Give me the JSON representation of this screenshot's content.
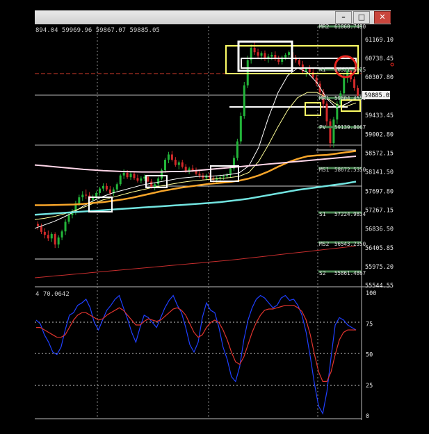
{
  "window": {
    "minimize_glyph": "–",
    "maximize_glyph": "□",
    "close_glyph": "✕"
  },
  "main_chart": {
    "ohlc_label": "894.04 59969.96 59867.07 59885.05",
    "price_axis": [
      "61169.10",
      "60738.45",
      "60307.80",
      "59885.05",
      "59433.45",
      "59002.80",
      "58572.15",
      "58141.50",
      "57697.80",
      "57267.15",
      "56836.50",
      "56405.85",
      "55975.20",
      "55544.55"
    ],
    "current_price": "59885.05",
    "pivot_labels": [
      {
        "name": "MR2",
        "value": "61060.7490"
      },
      {
        "name": "R1",
        "value": "60521.5125"
      },
      {
        "name": "MR1",
        "value": "59804.4550"
      },
      {
        "name": "PV",
        "value": "59139.8067"
      },
      {
        "name": "MS1",
        "value": "58672.5350"
      },
      {
        "name": "S1",
        "value": "57224.9834"
      },
      {
        "name": "MS2",
        "value": "56543.2350"
      },
      {
        "name": "S2",
        "value": "55861.4867"
      }
    ]
  },
  "oscillator": {
    "label": "4 70.0642",
    "axis": [
      "100",
      "75",
      "50",
      "25",
      "0"
    ]
  },
  "chart_data": [
    {
      "type": "candlestick",
      "ylim": [
        55544.55,
        61380
      ],
      "candles": [
        [
          56950,
          57010,
          56820,
          56900
        ],
        [
          56900,
          56960,
          56720,
          56770
        ],
        [
          56770,
          56850,
          56620,
          56700
        ],
        [
          56700,
          56800,
          56560,
          56620
        ],
        [
          56620,
          56760,
          56540,
          56720
        ],
        [
          56720,
          56760,
          56400,
          56480
        ],
        [
          56480,
          56690,
          56400,
          56640
        ],
        [
          56640,
          56820,
          56580,
          56780
        ],
        [
          56780,
          57060,
          56700,
          57000
        ],
        [
          57000,
          57200,
          56950,
          57150
        ],
        [
          57150,
          57290,
          57080,
          57220
        ],
        [
          57220,
          57480,
          57160,
          57420
        ],
        [
          57420,
          57620,
          57360,
          57560
        ],
        [
          57560,
          57700,
          57480,
          57620
        ],
        [
          57620,
          57740,
          57520,
          57600
        ],
        [
          57600,
          57680,
          57440,
          57500
        ],
        [
          57500,
          57620,
          57420,
          57580
        ],
        [
          57580,
          57700,
          57520,
          57660
        ],
        [
          57660,
          57800,
          57600,
          57760
        ],
        [
          57760,
          57880,
          57700,
          57820
        ],
        [
          57820,
          57880,
          57700,
          57740
        ],
        [
          57740,
          57820,
          57600,
          57650
        ],
        [
          57650,
          57790,
          57590,
          57740
        ],
        [
          57740,
          57900,
          57680,
          57860
        ],
        [
          57860,
          58100,
          57820,
          58060
        ],
        [
          58060,
          58200,
          57980,
          58120
        ],
        [
          58120,
          58180,
          57980,
          58020
        ],
        [
          58020,
          58140,
          57960,
          58100
        ],
        [
          58100,
          58160,
          57960,
          58000
        ],
        [
          58000,
          58080,
          57900,
          57940
        ],
        [
          57940,
          58040,
          57880,
          57990
        ],
        [
          57990,
          58080,
          57930,
          58030
        ],
        [
          58030,
          58070,
          57900,
          57920
        ],
        [
          57920,
          57980,
          57760,
          57800
        ],
        [
          57800,
          57900,
          57720,
          57860
        ],
        [
          57860,
          58030,
          57820,
          57990
        ],
        [
          57990,
          58220,
          57950,
          58180
        ],
        [
          58180,
          58460,
          58120,
          58420
        ],
        [
          58420,
          58600,
          58340,
          58540
        ],
        [
          58540,
          58620,
          58380,
          58420
        ],
        [
          58420,
          58480,
          58260,
          58300
        ],
        [
          58300,
          58400,
          58200,
          58360
        ],
        [
          58360,
          58420,
          58220,
          58260
        ],
        [
          58260,
          58320,
          58120,
          58170
        ],
        [
          58170,
          58260,
          58090,
          58220
        ],
        [
          58220,
          58300,
          58140,
          58180
        ],
        [
          58180,
          58240,
          58060,
          58100
        ],
        [
          58100,
          58160,
          58000,
          58060
        ],
        [
          58060,
          58120,
          57960,
          58000
        ],
        [
          58000,
          58100,
          57950,
          58060
        ],
        [
          58060,
          58120,
          57960,
          58000
        ],
        [
          58000,
          58060,
          57900,
          57960
        ],
        [
          57960,
          58040,
          57900,
          58000
        ],
        [
          58000,
          58080,
          57940,
          58020
        ],
        [
          58020,
          58080,
          57960,
          58040
        ],
        [
          58040,
          58120,
          57980,
          58080
        ],
        [
          58080,
          58260,
          58020,
          58220
        ],
        [
          58220,
          58520,
          58160,
          58460
        ],
        [
          58460,
          58900,
          58400,
          58840
        ],
        [
          58840,
          59500,
          58780,
          59420
        ],
        [
          59420,
          60200,
          59360,
          60120
        ],
        [
          60120,
          60800,
          60060,
          60700
        ],
        [
          60700,
          61060,
          60620,
          60980
        ],
        [
          60980,
          61100,
          60820,
          60880
        ],
        [
          60880,
          60960,
          60720,
          60800
        ],
        [
          60800,
          60900,
          60700,
          60860
        ],
        [
          60860,
          60920,
          60680,
          60740
        ],
        [
          60740,
          60840,
          60640,
          60780
        ],
        [
          60780,
          60880,
          60700,
          60820
        ],
        [
          60820,
          60900,
          60680,
          60720
        ],
        [
          60720,
          60800,
          60600,
          60660
        ],
        [
          60660,
          60800,
          60600,
          60760
        ],
        [
          60760,
          60860,
          60700,
          60820
        ],
        [
          60820,
          60920,
          60760,
          60880
        ],
        [
          60880,
          60900,
          60720,
          60760
        ],
        [
          60760,
          60820,
          60640,
          60700
        ],
        [
          60700,
          60760,
          60560,
          60600
        ],
        [
          60600,
          60680,
          60380,
          60440
        ],
        [
          60440,
          60540,
          60320,
          60500
        ],
        [
          60500,
          60580,
          60380,
          60420
        ],
        [
          60420,
          60500,
          60260,
          60300
        ],
        [
          60300,
          60360,
          60100,
          60160
        ],
        [
          60160,
          60220,
          59900,
          59960
        ],
        [
          59960,
          60040,
          59600,
          59700
        ],
        [
          59700,
          59760,
          59200,
          59300
        ],
        [
          59300,
          59360,
          58700,
          58800
        ],
        [
          58800,
          59400,
          58700,
          59340
        ],
        [
          59340,
          59760,
          59240,
          59700
        ],
        [
          59700,
          60000,
          59620,
          59940
        ],
        [
          59940,
          60400,
          59880,
          60320
        ],
        [
          60320,
          60520,
          60180,
          60460
        ],
        [
          60460,
          60540,
          60200,
          60260
        ],
        [
          60260,
          60320,
          60000,
          60060
        ],
        [
          60060,
          60120,
          59840,
          59885
        ]
      ]
    },
    {
      "type": "line",
      "series": [
        {
          "color": "#ffffff",
          "values": [
            56850,
            56930,
            57010,
            57110,
            57220,
            57360,
            57480,
            57580,
            57660,
            57720,
            57780,
            57840,
            57880,
            57920,
            57960,
            58000,
            58020,
            58040,
            58040,
            58060,
            58080,
            58120,
            58280,
            58700,
            59380,
            59960,
            60350,
            60520,
            60420,
            60180,
            59820,
            59600,
            59700,
            59820
          ]
        },
        {
          "color": "#ffff99",
          "values": [
            57050,
            57080,
            57120,
            57180,
            57250,
            57330,
            57420,
            57500,
            57560,
            57620,
            57680,
            57730,
            57780,
            57820,
            57860,
            57900,
            57930,
            57950,
            57970,
            57990,
            58010,
            58040,
            58130,
            58380,
            58760,
            59180,
            59560,
            59840,
            59960,
            59960,
            59840,
            59680,
            59640,
            59720
          ]
        },
        {
          "color": "#f7a52a",
          "values": [
            57380,
            57380,
            57385,
            57390,
            57395,
            57410,
            57430,
            57450,
            57480,
            57510,
            57550,
            57600,
            57650,
            57700,
            57740,
            57780,
            57810,
            57840,
            57870,
            57890,
            57910,
            57940,
            57990,
            58060,
            58150,
            58260,
            58360,
            58440,
            58500,
            58520,
            58530,
            58560,
            58590,
            58620
          ]
        },
        {
          "color": "#ffd6e8",
          "values": [
            58300,
            58280,
            58260,
            58240,
            58220,
            58200,
            58185,
            58170,
            58160,
            58150,
            58145,
            58140,
            58140,
            58140,
            58150,
            58150,
            58160,
            58180,
            58200,
            58220,
            58240,
            58260,
            58280,
            58300,
            58320,
            58340,
            58360,
            58380,
            58400,
            58420,
            58440,
            58460,
            58480,
            58500
          ]
        },
        {
          "color": "#72e4e0",
          "values": [
            57160,
            57175,
            57190,
            57205,
            57220,
            57235,
            57250,
            57265,
            57280,
            57295,
            57310,
            57325,
            57340,
            57355,
            57370,
            57385,
            57400,
            57415,
            57430,
            57450,
            57475,
            57500,
            57530,
            57570,
            57610,
            57650,
            57690,
            57730,
            57760,
            57790,
            57820,
            57850,
            57880,
            57920
          ]
        },
        {
          "color": "#c62d2d",
          "values": [
            55720,
            55740,
            55760,
            55780,
            55800,
            55820,
            55840,
            55860,
            55880,
            55900,
            55920,
            55940,
            55960,
            55980,
            56000,
            56020,
            56040,
            56060,
            56080,
            56100,
            56120,
            56145,
            56170,
            56195,
            56220,
            56245,
            56270,
            56295,
            56320,
            56345,
            56370,
            56395,
            56420,
            56450
          ]
        }
      ]
    },
    {
      "type": "line",
      "ylim": [
        0,
        100
      ],
      "series": [
        {
          "color": "#1f3fff",
          "values": [
            78,
            75,
            66,
            60,
            52,
            50,
            56,
            70,
            82,
            84,
            90,
            92,
            95,
            88,
            76,
            70,
            78,
            86,
            90,
            95,
            98,
            88,
            79,
            68,
            60,
            72,
            82,
            80,
            76,
            72,
            80,
            88,
            94,
            98,
            90,
            84,
            72,
            58,
            52,
            60,
            80,
            92,
            86,
            84,
            72,
            56,
            46,
            32,
            28,
            40,
            62,
            78,
            88,
            95,
            98,
            96,
            92,
            88,
            90,
            96,
            98,
            94,
            95,
            90,
            82,
            68,
            48,
            26,
            8,
            2,
            20,
            48,
            74,
            80,
            78,
            74,
            72,
            70
          ]
        },
        {
          "color": "#e0342e",
          "values": [
            72,
            72,
            70,
            68,
            66,
            64,
            64,
            66,
            72,
            78,
            82,
            84,
            84,
            82,
            80,
            78,
            79,
            82,
            84,
            86,
            88,
            86,
            82,
            78,
            74,
            74,
            77,
            79,
            78,
            77,
            78,
            81,
            84,
            87,
            88,
            86,
            82,
            75,
            68,
            64,
            66,
            72,
            76,
            78,
            76,
            70,
            62,
            52,
            44,
            42,
            48,
            58,
            68,
            76,
            82,
            86,
            87,
            87,
            88,
            89,
            90,
            90,
            90,
            88,
            85,
            78,
            66,
            50,
            36,
            28,
            28,
            36,
            50,
            62,
            68,
            70,
            70,
            70
          ]
        }
      ]
    }
  ]
}
